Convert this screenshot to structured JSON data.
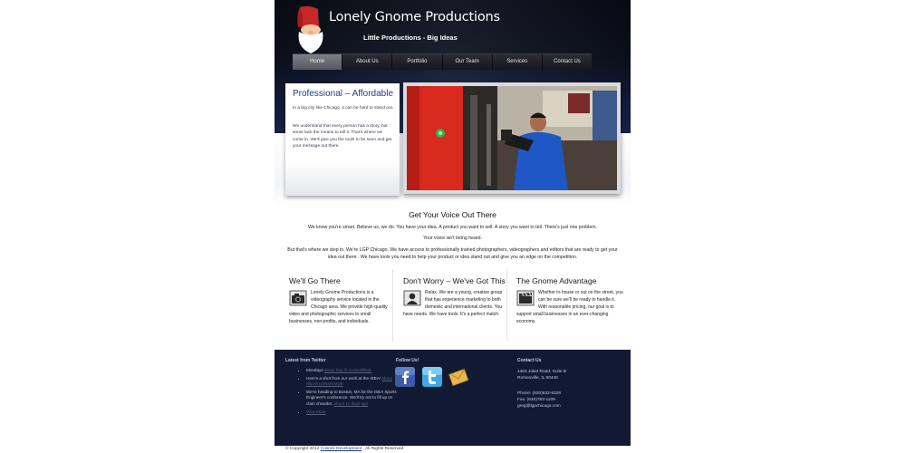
{
  "header": {
    "brand_name": "Lonely Gnome Productions",
    "tagline": "Little Productions - Big Ideas"
  },
  "nav": {
    "items": [
      {
        "label": "Home",
        "active": true
      },
      {
        "label": "About Us",
        "active": false
      },
      {
        "label": "Portfolio",
        "active": false
      },
      {
        "label": "Our Team",
        "active": false
      },
      {
        "label": "Services",
        "active": false
      },
      {
        "label": "Contact Us",
        "active": false
      }
    ]
  },
  "intro": {
    "title": "Professional – Affordable",
    "paragraphs": [
      "In a big city like Chicago, it can be hard to stand out.",
      "We understand that every person has a story, but some lack the means to tell it. That's where we come in. We'll give you the tools to be seen and get your message out there."
    ]
  },
  "main": {
    "title": "Get Your Voice Out There",
    "paragraphs": [
      "We know you're smart. Believe us, we do. You have your idea. A product you want to sell. A story you want to tell. There's just one problem.",
      "Your voice isn't being heard.",
      "But that's where we step in. We're LGP Chicago. We have access to professionally trained photographers, videographers and editors that are ready to get your idea out there . We have tools you need to help your product or idea stand out and give you an edge on the competition."
    ]
  },
  "columns": [
    {
      "title": "We'll Go There",
      "icon": "camera-icon",
      "text": "Lonely Gnome Productions is a videography service located in the Chicago area.  We provide high-quality video and photographic services to small businesses, non-profits, and individuals."
    },
    {
      "title": "Don't Worry – We've Got This",
      "icon": "person-icon",
      "text": "Relax. We are a young, creative group that has experience marketing to both domestic and international clients. You have needs. We have tools. It's a perfect match."
    },
    {
      "title": "The Gnome Advantage",
      "icon": "film-clapper-icon",
      "text": "Whether in-house or out on the street, you can be sure we'll be ready to handle it. With reasonable pricing, our goal is to support small businesses in an ever-changing economy."
    }
  ],
  "footer": {
    "twitter_heading": "Latest from Twitter",
    "tweets": [
      {
        "text": "Mondays ",
        "link": "about http://t.co/JwSfRaE"
      },
      {
        "text": "Here's a shot from our work at the ISEA! ",
        "link": "about http://t.co/NoHoXpB"
      },
      {
        "text": "We're heading to Boston, MA for the ISEA Sports Engineer's conference. We'll try not to fill up on clam chowder. ",
        "link": "about 11 days ago"
      }
    ],
    "more_link": "View More",
    "follow_heading": "Follow Us!",
    "follow_icons": [
      "facebook-icon",
      "twitter-icon",
      "email-icon"
    ],
    "contact_heading": "Contact Us",
    "contact_lines": [
      "1404 Joliet Road, Suite B",
      "Romeoville, IL 60446",
      "Phone: (630)632-5326",
      "Fax: (630)783-1109",
      "greg@lgpchicago.com"
    ]
  },
  "copyright": {
    "prefix": "© Copyright 2012 ",
    "link": "Cosmik Development",
    "suffix": " . All Rights Reserved"
  }
}
